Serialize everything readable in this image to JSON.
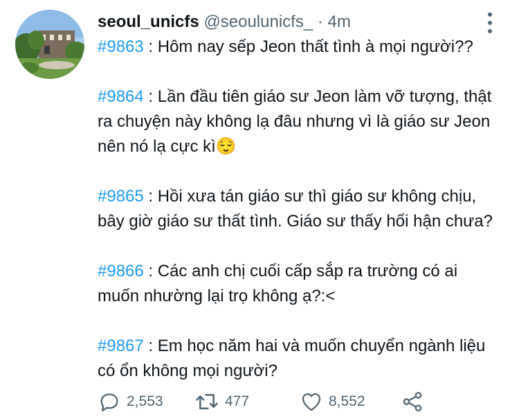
{
  "tweet": {
    "author": {
      "display_name": "seoul_unicfs",
      "handle": "@seoulunicfs_",
      "separator": "·",
      "time": "4m"
    },
    "posts": [
      {
        "tag": "#9863",
        "text": " : Hôm nay sếp Jeon thất tình à mọi người??"
      },
      {
        "tag": "#9864",
        "text": " : Lần đầu tiên giáo sư Jeon làm vỡ tượng, thật ra chuyện này không lạ đâu nhưng vì là giáo sư Jeon nên nó lạ cực kì😌"
      },
      {
        "tag": "#9865",
        "text": " : Hồi xưa tán giáo sư thì giáo sư không chịu, bây giờ giáo sư thất tình. Giáo sư thấy hối hận chưa?"
      },
      {
        "tag": "#9866",
        "text": " : Các anh chị cuối cấp sắp ra trường có ai muốn nhường lại trọ không ạ?:<"
      },
      {
        "tag": "#9867",
        "text": " : Em học năm hai và muốn chuyển ngành liệu có ổn không mọi người?"
      }
    ],
    "actions": {
      "reply_count": "2,553",
      "retweet_count": "477",
      "like_count": "8,552"
    }
  },
  "icons": {
    "avatar": "avatar-photo",
    "more": "more-options-icon",
    "reply": "reply-icon",
    "retweet": "retweet-icon",
    "like": "like-icon",
    "share": "share-icon"
  },
  "colors": {
    "link": "#1d9bf0",
    "secondary_text": "#536471",
    "primary_text": "#0f1419"
  }
}
